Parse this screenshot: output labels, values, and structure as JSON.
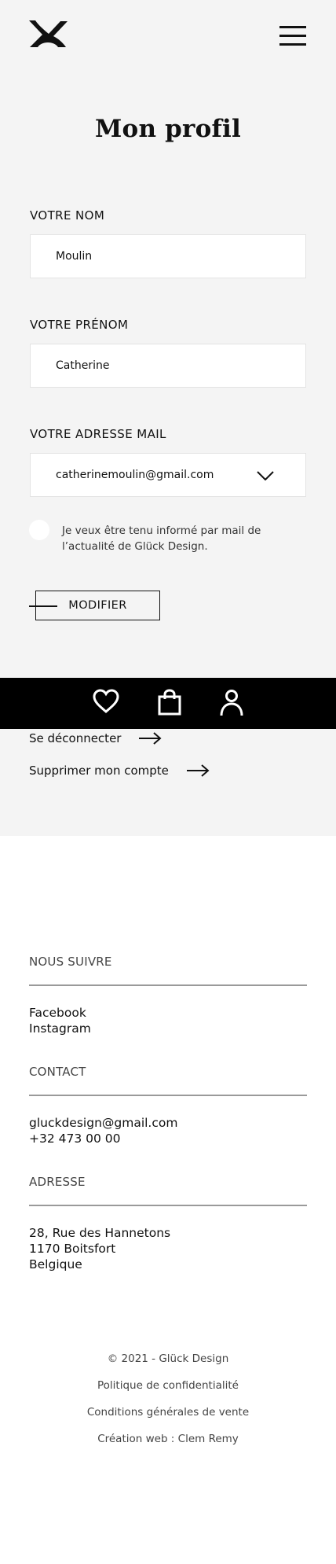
{
  "header": {
    "logo_icon": "gluck-design-logo-icon",
    "menu_icon": "hamburger-menu-icon"
  },
  "page": {
    "title": "Mon profil"
  },
  "form": {
    "last_name_label": "VOTRE NOM",
    "last_name_value": "Moulin",
    "first_name_label": "VOTRE PRÉNOM",
    "first_name_value": "Catherine",
    "email_label": "VOTRE ADRESSE MAIL",
    "email_value": "catherinemoulin@gmail.com",
    "newsletter_text": "Je veux être tenu informé par mail de l’actualité de Glück Design.",
    "newsletter_checked": false,
    "submit_label": "MODIFIER"
  },
  "bottom_bar": {
    "icons": [
      "heart-icon",
      "shopping-bag-icon",
      "user-icon"
    ],
    "background": "#000000"
  },
  "account_links": {
    "logout_label": "Se déconnecter",
    "delete_label": "Supprimer mon compte"
  },
  "footer": {
    "follow_heading": "NOUS SUIVRE",
    "social": [
      "Facebook",
      "Instagram"
    ],
    "contact_heading": "CONTACT",
    "email": "gluckdesign@gmail.com",
    "phone": "+32 473 00 00",
    "address_heading": "ADRESSE",
    "address_lines": [
      "28, Rue des Hannetons",
      "1170 Boitsfort",
      "Belgique"
    ],
    "copyright": "© 2021 - Glück Design",
    "privacy": "Politique de confidentialité",
    "terms": "Conditions générales de vente",
    "credit": "Création web : Clem Remy"
  },
  "colors": {
    "page_background": "#f4f4f4",
    "accent": "#111111",
    "field_background": "#ffffff"
  }
}
